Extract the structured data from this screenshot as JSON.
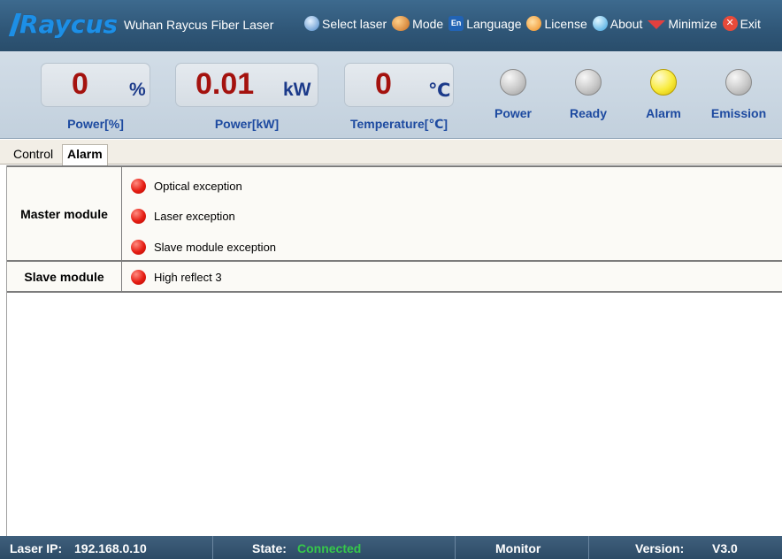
{
  "titlebar": {
    "brand": "Raycus",
    "app_title": "Wuhan Raycus Fiber Laser",
    "menu": [
      {
        "label": "Select laser",
        "icon": "globe-icon"
      },
      {
        "label": "Mode",
        "icon": "users-icon"
      },
      {
        "label": "Language",
        "icon": "language-en-icon"
      },
      {
        "label": "License",
        "icon": "key-icon"
      },
      {
        "label": "About",
        "icon": "info-globe-icon"
      },
      {
        "label": "Minimize",
        "icon": "minimize-icon"
      },
      {
        "label": "Exit",
        "icon": "close-icon"
      }
    ]
  },
  "readouts": [
    {
      "value": "0",
      "unit": "%",
      "label": "Power[%]"
    },
    {
      "value": "0.01",
      "unit": "kW",
      "label": "Power[kW]"
    },
    {
      "value": "0",
      "unit": "℃",
      "label": "Temperature[℃]"
    }
  ],
  "indicators": [
    {
      "label": "Power",
      "state": "off",
      "color": "#c9c9c9"
    },
    {
      "label": "Ready",
      "state": "off",
      "color": "#c9c9c9"
    },
    {
      "label": "Alarm",
      "state": "on",
      "color": "#f8eb3b"
    },
    {
      "label": "Emission",
      "state": "off",
      "color": "#c9c9c9"
    }
  ],
  "tabs": [
    {
      "label": "Control",
      "active": false
    },
    {
      "label": "Alarm",
      "active": true
    }
  ],
  "alarm": {
    "led_color": "#e51c12",
    "modules": [
      {
        "name": "Master module",
        "alarms": [
          "Optical exception",
          "Laser exception",
          "Slave module exception"
        ]
      },
      {
        "name": "Slave module",
        "alarms": [
          "High reflect 3"
        ]
      }
    ]
  },
  "statusbar": {
    "ip_label": "Laser IP:",
    "ip_value": "192.168.0.10",
    "state_label": "State:",
    "state_value": "Connected",
    "mode_value": "Monitor",
    "version_label": "Version:",
    "version_value": "V3.0"
  }
}
